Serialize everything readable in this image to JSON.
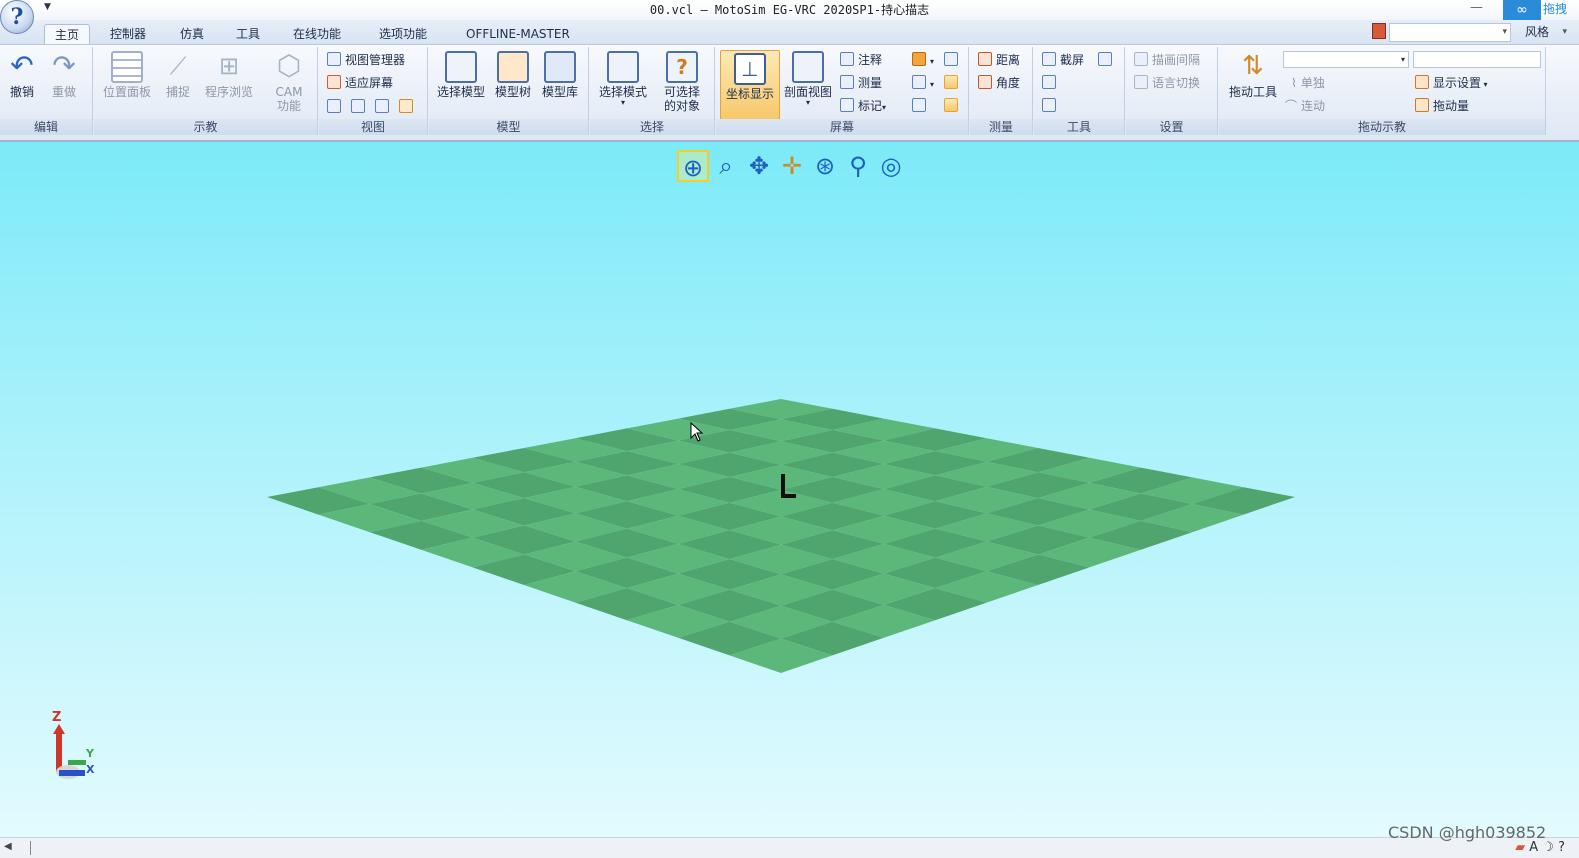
{
  "app": {
    "title": "00.vcl — MotoSim EG-VRC 2020SP1-持心描志",
    "top_right_label": "拖拽",
    "window_minimize": "—"
  },
  "tabs": [
    "主页",
    "控制器",
    "仿真",
    "工具",
    "在线功能",
    "选项功能",
    "OFFLINE-MASTER"
  ],
  "active_tab": "主页",
  "style_label": "风格",
  "ribbon": {
    "edit": {
      "label": "编辑",
      "undo": "撤销",
      "redo": "重做"
    },
    "teach": {
      "label": "示教",
      "position_panel": "位置面板",
      "capture": "捕捉",
      "program_browse": "程序浏览",
      "cam_line1": "CAM",
      "cam_line2": "功能"
    },
    "view": {
      "label": "视图",
      "view_manager": "视图管理器",
      "fit_screen": "适应屏幕"
    },
    "model": {
      "label": "模型",
      "select_model": "选择模型",
      "model_tree": "模型树",
      "model_library": "模型库"
    },
    "select": {
      "label": "选择",
      "select_mode": "选择模式",
      "selectable_line1": "可选择",
      "selectable_line2": "的对象"
    },
    "screen": {
      "label": "屏幕",
      "coord_display": "坐标显示",
      "section_view": "剖面视图",
      "annotate": "注释",
      "measure_dim": "测量",
      "mark": "标记"
    },
    "measure": {
      "label": "测量",
      "distance": "距离",
      "angle": "角度"
    },
    "tools": {
      "label": "工具",
      "screenshot": "截屏"
    },
    "settings": {
      "label": "设置",
      "draw_interval": "描画间隔",
      "language_switch": "语言切换"
    },
    "drag_teach": {
      "label": "拖动示教",
      "drag_tool": "拖动工具",
      "single": "单独",
      "linked": "连动",
      "display_settings": "显示设置",
      "drag_amount": "拖动量"
    }
  },
  "viewport": {
    "axis_labels": {
      "z": "Z",
      "y": "Y",
      "x": "X"
    },
    "tools": [
      "rotate-view",
      "zoom-box",
      "rotate-free",
      "pan",
      "rotate-z",
      "zoom",
      "target"
    ]
  },
  "watermark": "CSDN @hgh039852",
  "colors": {
    "sky_top": "#7ceaf8",
    "sky_bottom": "#e3fbfe",
    "floor_light": "#5cb87a",
    "floor_dark": "#4fa56d",
    "accent": "#2a8bd8"
  }
}
